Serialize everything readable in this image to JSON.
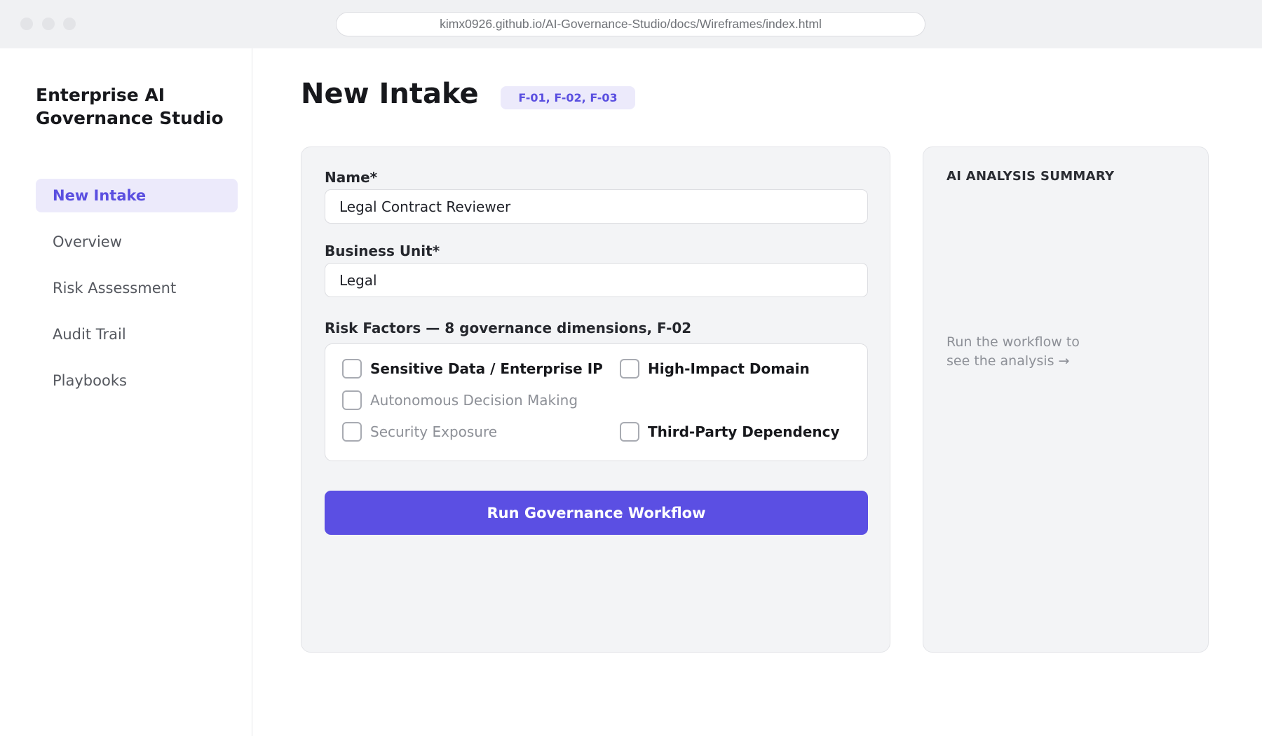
{
  "browser": {
    "url": "kimx0926.github.io/AI-Governance-Studio/docs/Wireframes/index.html"
  },
  "sidebar": {
    "brand": "Enterprise AI Governance Studio",
    "items": [
      {
        "label": "New Intake",
        "active": true
      },
      {
        "label": "Overview",
        "active": false
      },
      {
        "label": "Risk Assessment",
        "active": false
      },
      {
        "label": "Audit Trail",
        "active": false
      },
      {
        "label": "Playbooks",
        "active": false
      }
    ]
  },
  "main": {
    "title": "New Intake",
    "tag": "F-01, F-02, F-03",
    "form": {
      "name_label": "Name*",
      "name_value": "Legal Contract Reviewer",
      "business_unit_label": "Business Unit*",
      "business_unit_value": "Legal",
      "risk_label": "Risk Factors — 8 governance dimensions, F-02",
      "risk_factors": [
        {
          "label": "Sensitive Data / Enterprise IP",
          "checked": false,
          "emphasis": "strong"
        },
        {
          "label": "High-Impact Domain",
          "checked": false,
          "emphasis": "strong"
        },
        {
          "label": "Autonomous Decision Making",
          "checked": false,
          "emphasis": "muted"
        },
        {
          "label": "Security Exposure",
          "checked": false,
          "emphasis": "muted"
        },
        {
          "label": "Third-Party Dependency",
          "checked": false,
          "emphasis": "strong"
        }
      ],
      "submit_label": "Run Governance Workflow"
    },
    "summary": {
      "title": "AI ANALYSIS SUMMARY",
      "empty_text": "Run the workflow to see the analysis →"
    }
  },
  "colors": {
    "accent": "#5b4fe3",
    "accent_soft": "#eceafb",
    "panel": "#f3f4f6"
  }
}
